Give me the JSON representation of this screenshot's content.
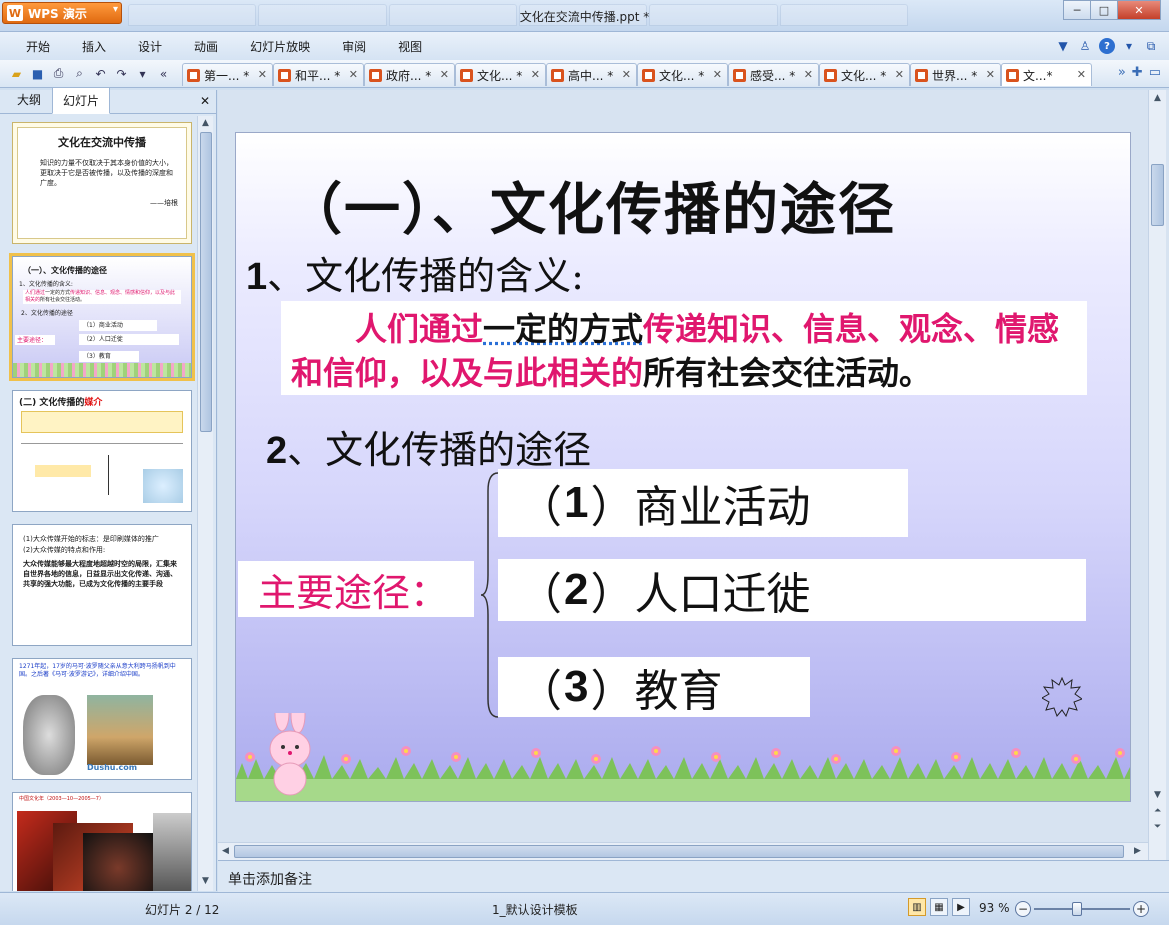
{
  "app": {
    "button_label": "WPS 演示",
    "title": "文化在交流中传播.ppt *"
  },
  "window_controls": {
    "minimize": "─",
    "maximize": "□",
    "close": "✕"
  },
  "menu": [
    "开始",
    "插入",
    "设计",
    "动画",
    "幻灯片放映",
    "审阅",
    "视图"
  ],
  "doc_tabs": [
    {
      "label": "第一... *"
    },
    {
      "label": "和平... *"
    },
    {
      "label": "政府... *"
    },
    {
      "label": "文化... *"
    },
    {
      "label": "高中... *"
    },
    {
      "label": "文化... *"
    },
    {
      "label": "感受... *"
    },
    {
      "label": "文化... *"
    },
    {
      "label": "世界... *"
    },
    {
      "label": "文...*"
    }
  ],
  "left_panel": {
    "tab_outline": "大纲",
    "tab_slides": "幻灯片",
    "close": "✕"
  },
  "thumbnails": [
    {
      "num": "1",
      "title": "文化在交流中传播",
      "body": "知识的力量不仅取决于其本身价值的大小，更取决于它是否被传播，以及传播的深度和广度。",
      "author": "——培根"
    },
    {
      "num": "2"
    },
    {
      "num": "3",
      "title_prefix": "(二) 文化传播的",
      "title_red": "媒介"
    },
    {
      "num": "4",
      "line1": "(1)大众传媒开始的标志：是印刷媒体的推广",
      "line2": "(2)大众传媒的特点和作用:",
      "body": "大众传媒能够最大程度地超越时空的局限，汇集来自世界各地的信息，日益显示出文化传递、沟通、共享的强大功能，已成为文化传播的主要手段"
    },
    {
      "num": "5",
      "caption": "1271年起，17岁的马可·波罗随父亲从意大利跨马扬帆到中国。之后著《马可·波罗游记》，详细介绍中国。",
      "logo": "Dushu.com"
    },
    {
      "num": "6",
      "caption": "中国文化年（2003—10—2005—7）"
    }
  ],
  "slide": {
    "title": "（一）、文化传播的途径",
    "sub1_num": "1",
    "sub1_text": "、文化传播的含义:",
    "definition": {
      "p1": "人们通过",
      "p2": "一定的方式",
      "p3": "传递知识、信息、观念、情感和信仰，以及与此相关的",
      "p4": "所有社会交往活动。"
    },
    "sub2_num": "2",
    "sub2_text": "、文化传播的途径",
    "main_route_label": "主要途径：",
    "routes": [
      {
        "open": "（",
        "num": "1",
        "close": "）",
        "label": "商业活动"
      },
      {
        "open": "（",
        "num": "2",
        "close": "）",
        "label": "人口迁徙"
      },
      {
        "open": "（",
        "num": "3",
        "close": "）",
        "label": "教育"
      }
    ]
  },
  "notes_placeholder": "单击添加备注",
  "status": {
    "slide_pos": "幻灯片 2 / 12",
    "template": "1_默认设计模板",
    "zoom": "93 %"
  },
  "colors": {
    "accent_pink": "#e0176e",
    "wps_orange": "#e06a10"
  }
}
